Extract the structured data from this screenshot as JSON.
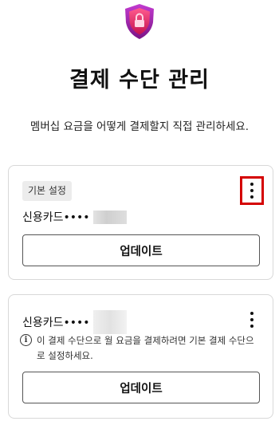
{
  "header": {
    "icon": "shield-lock-icon",
    "title": "결제 수단 관리",
    "subtitle": "멤버십 요금을 어떻게 결제할지 직접 관리하세요."
  },
  "colors": {
    "shield_outer": "#a21ea8",
    "shield_inner": "#e0216b",
    "highlight_border": "#d40000"
  },
  "payment_methods": [
    {
      "badge": "기본 설정",
      "label": "신용카드••••",
      "menu_icon": "more-vertical-icon",
      "button_label": "업데이트"
    },
    {
      "label": "신용카드••••",
      "menu_icon": "more-vertical-icon",
      "info_icon": "info-icon",
      "info_text": "이 결제 수단으로 월 요금을 결제하려면 기본 결제 수단으로 설정하세요.",
      "button_label": "업데이트"
    }
  ]
}
